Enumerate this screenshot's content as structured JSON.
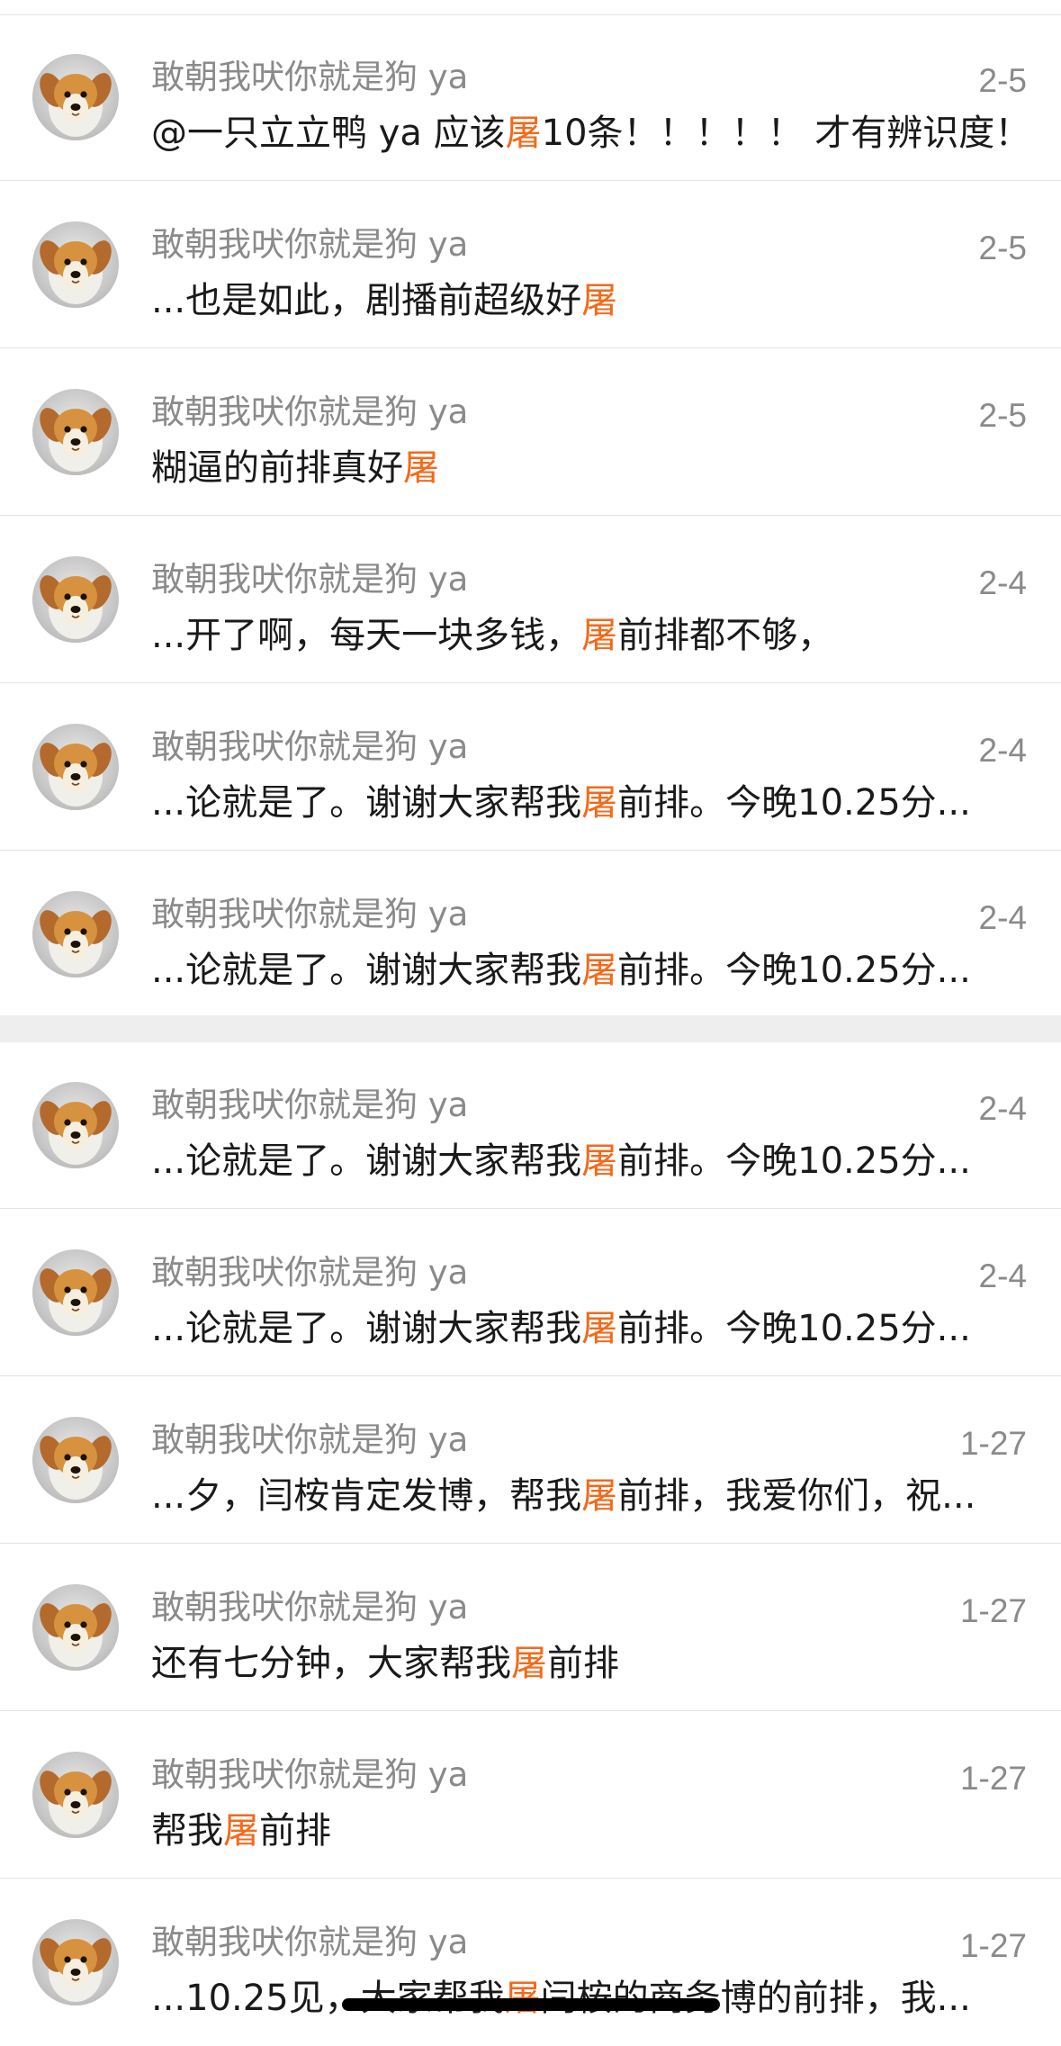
{
  "colors": {
    "highlight": "#f26a1b",
    "meta_text": "#8a8a8a",
    "body_text": "#1a1a1a",
    "divider": "#e3e3e3"
  },
  "results": [
    {
      "user": "敢朝我吠你就是狗 ya",
      "date": "2-5",
      "before": "@一只立立鸭 ya 应该",
      "keyword": "屠",
      "after": "10条！！！！！ 才有辨识度！..."
    },
    {
      "user": "敢朝我吠你就是狗 ya",
      "date": "2-5",
      "before": "...也是如此，剧播前超级好",
      "keyword": "屠",
      "after": ""
    },
    {
      "user": "敢朝我吠你就是狗 ya",
      "date": "2-5",
      "before": "糊逼的前排真好",
      "keyword": "屠",
      "after": ""
    },
    {
      "user": "敢朝我吠你就是狗 ya",
      "date": "2-4",
      "before": "...开了啊，每天一块多钱，",
      "keyword": "屠",
      "after": "前排都不够，"
    },
    {
      "user": "敢朝我吠你就是狗 ya",
      "date": "2-4",
      "before": "...论就是了。谢谢大家帮我",
      "keyword": "屠",
      "after": "前排。今晚10.25分..."
    },
    {
      "user": "敢朝我吠你就是狗 ya",
      "date": "2-4",
      "before": "...论就是了。谢谢大家帮我",
      "keyword": "屠",
      "after": "前排。今晚10.25分..."
    },
    {
      "user": "敢朝我吠你就是狗 ya",
      "date": "2-4",
      "before": "...论就是了。谢谢大家帮我",
      "keyword": "屠",
      "after": "前排。今晚10.25分..."
    },
    {
      "user": "敢朝我吠你就是狗 ya",
      "date": "2-4",
      "before": "...论就是了。谢谢大家帮我",
      "keyword": "屠",
      "after": "前排。今晚10.25分..."
    },
    {
      "user": "敢朝我吠你就是狗 ya",
      "date": "1-27",
      "before": "...夕，闫桉肯定发博，帮我",
      "keyword": "屠",
      "after": "前排，我爱你们，祝..."
    },
    {
      "user": "敢朝我吠你就是狗 ya",
      "date": "1-27",
      "before": "还有七分钟，大家帮我",
      "keyword": "屠",
      "after": "前排"
    },
    {
      "user": "敢朝我吠你就是狗 ya",
      "date": "1-27",
      "before": "帮我",
      "keyword": "屠",
      "after": "前排"
    },
    {
      "user": "敢朝我吠你就是狗 ya",
      "date": "1-27",
      "before": "...10.25见，大家帮我",
      "keyword": "屠",
      "after": "闫桉的商务博的前排，我..."
    }
  ]
}
